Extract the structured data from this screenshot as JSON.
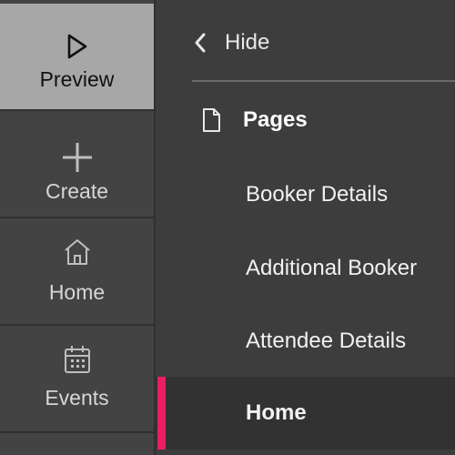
{
  "rail": {
    "items": [
      {
        "label": "Preview",
        "icon": "play-outline-icon"
      },
      {
        "label": "Create",
        "icon": "plus-icon"
      },
      {
        "label": "Home",
        "icon": "home-icon"
      },
      {
        "label": "Events",
        "icon": "calendar-icon"
      }
    ]
  },
  "drawer": {
    "hide_label": "Hide",
    "section_title": "Pages",
    "pages": [
      {
        "label": "Booker Details"
      },
      {
        "label": "Additional Booker"
      },
      {
        "label": "Attendee Details"
      },
      {
        "label": "Home"
      }
    ]
  },
  "colors": {
    "accent": "#e91e63",
    "active_rail_bg": "#a7a7a7",
    "rail_bg": "#434343",
    "drawer_bg": "#3d3d3d",
    "selected_bg": "#323232"
  }
}
